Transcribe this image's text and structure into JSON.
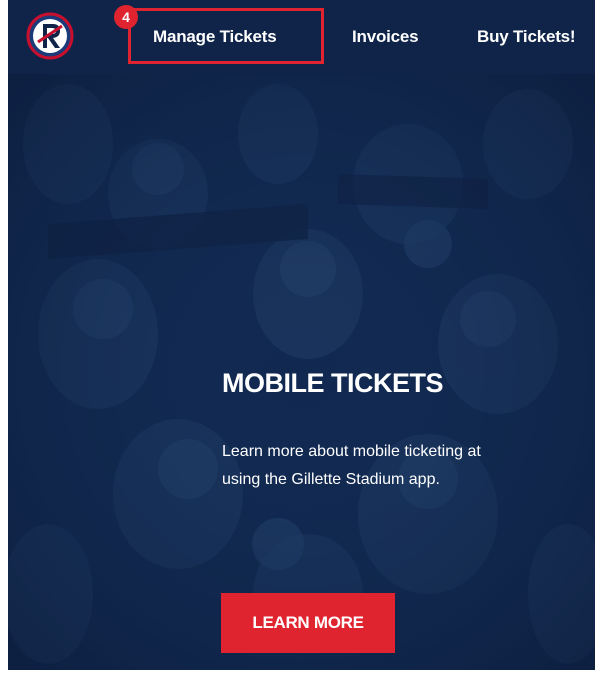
{
  "nav": {
    "items": [
      {
        "label": "Manage Tickets"
      },
      {
        "label": "Invoices"
      },
      {
        "label": "Buy Tickets!"
      }
    ],
    "logo_icon": "revolution-r-crest-icon"
  },
  "annotation": {
    "step_number": "4",
    "color": "#e0242f"
  },
  "hero": {
    "title": "MOBILE TICKETS",
    "body_line_1": "Learn more about mobile ticketing at",
    "body_line_2": "using the Gillette Stadium app.",
    "cta_label": "LEARN MORE",
    "background": "crowd-of-fans-photo"
  },
  "colors": {
    "navy": "#0f2448",
    "accent_red": "#e0242f"
  }
}
